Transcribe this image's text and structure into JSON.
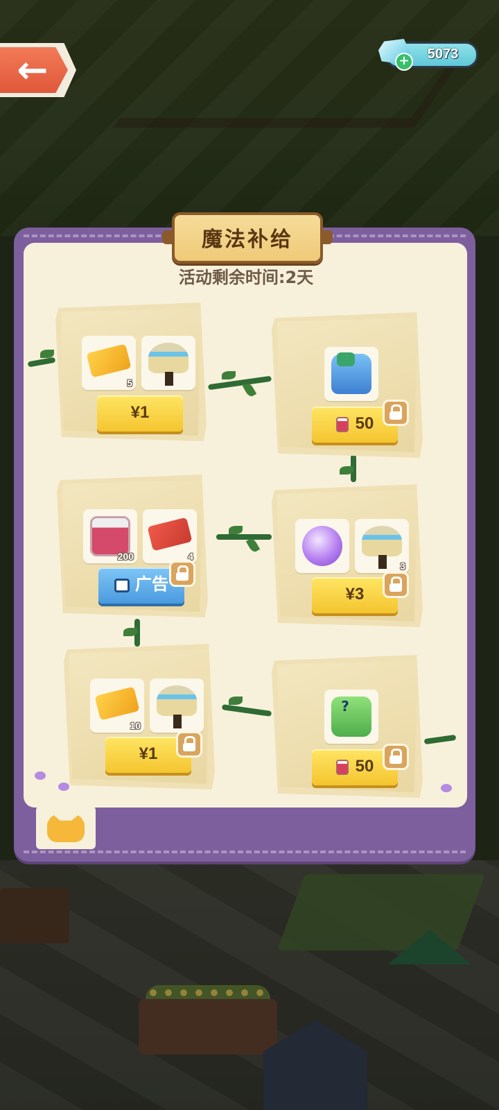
{
  "header": {
    "back_icon": "arrow-left-icon",
    "gems": {
      "icon": "diamond-icon",
      "amount": "5073"
    }
  },
  "panel": {
    "title": "魔法补给",
    "timer": "活动剩余时间:2天",
    "colors": {
      "frame": "#7d5f9e",
      "board": "#f7f1dc",
      "button": "#f4c52f",
      "ad_button": "#4a9ae0"
    }
  },
  "cards": [
    {
      "items": [
        {
          "icon": "gold-ticket-icon",
          "count": "5"
        },
        {
          "icon": "magic-pot-icon",
          "count": ""
        }
      ],
      "button": {
        "label": "¥1",
        "type": "price"
      },
      "locked": false
    },
    {
      "items": [
        {
          "icon": "headphone-cat-bag-icon",
          "count": ""
        }
      ],
      "button": {
        "label": "50",
        "type": "jam",
        "icon": "jam-jar-icon"
      },
      "locked": true
    },
    {
      "items": [
        {
          "icon": "jam-jar-icon",
          "count": "200"
        },
        {
          "icon": "event-ticket-icon",
          "count": "4"
        }
      ],
      "button": {
        "label": "广告",
        "type": "ad",
        "icon": "tv-icon"
      },
      "locked": true
    },
    {
      "items": [
        {
          "icon": "magic-orb-icon",
          "count": ""
        },
        {
          "icon": "magic-pot-icon",
          "count": "3"
        }
      ],
      "button": {
        "label": "¥3",
        "type": "price"
      },
      "locked": true
    },
    {
      "items": [
        {
          "icon": "gold-ticket-icon",
          "count": "10"
        },
        {
          "icon": "magic-pot-icon",
          "count": ""
        }
      ],
      "button": {
        "label": "¥1",
        "type": "price"
      },
      "locked": true
    },
    {
      "items": [
        {
          "icon": "mystery-bag-icon",
          "count": ""
        }
      ],
      "button": {
        "label": "50",
        "type": "jam",
        "icon": "jam-jar-icon"
      },
      "locked": true
    }
  ],
  "bottom_tab": {
    "icon": "cat-face-icon"
  }
}
